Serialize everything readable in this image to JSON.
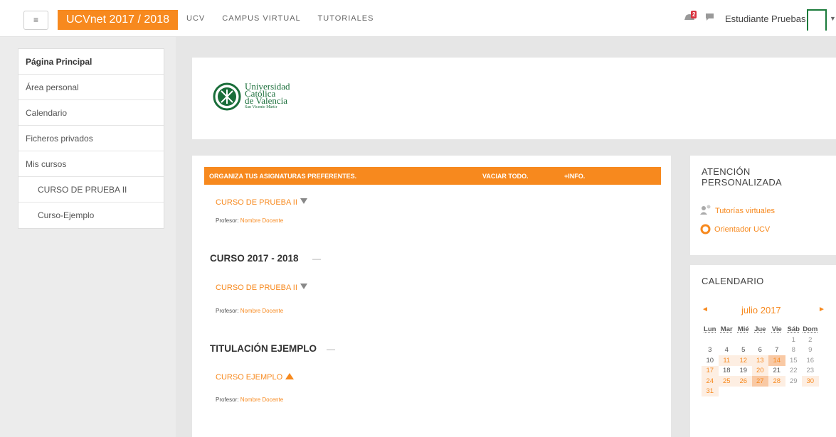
{
  "navbar": {
    "menu_icon": "hamburger-icon",
    "brand": "UCVnet 2017 / 2018",
    "links": [
      "UCV",
      "CAMPUS VIRTUAL",
      "TUTORIALES"
    ],
    "notification_count": "2",
    "username": "Estudiante Pruebas"
  },
  "sidebar": {
    "items": [
      {
        "label": "Página Principal"
      },
      {
        "label": "Área personal"
      },
      {
        "label": "Calendario"
      },
      {
        "label": "Ficheros privados"
      },
      {
        "label": "Mis cursos"
      },
      {
        "label": "CURSO DE PRUEBA II"
      },
      {
        "label": "Curso-Ejemplo"
      }
    ]
  },
  "logo": {
    "line1": "Universidad",
    "line2": "Católica",
    "line3": "de Valencia",
    "line4": "San Vicente Mártir"
  },
  "main": {
    "org_bar": {
      "title": "ORGANIZA TUS ASIGNATURAS PREFERENTES.",
      "clear_all": "VACIAR TODO.",
      "more_info": "+INFO."
    },
    "favorite_course": {
      "name": "CURSO DE PRUEBA II",
      "teacher_label": "Profesor:",
      "teacher_name": "Nombre Docente"
    },
    "sections": [
      {
        "title": "CURSO 2017 - 2018",
        "toggle": "—",
        "course": "CURSO DE PRUEBA II",
        "teacher_label": "Profesor:",
        "teacher_name": "Nombre Docente"
      },
      {
        "title": "TITULACIÓN EJEMPLO",
        "toggle": "—",
        "course": "CURSO EJEMPLO",
        "teacher_label": "Profesor:",
        "teacher_name": "Nombre Docente"
      }
    ]
  },
  "attention": {
    "title_line1": "ATENCIÓN",
    "title_line2": "PERSONALIZADA",
    "links": [
      {
        "label": "Tutorías virtuales",
        "icon": "users-icon"
      },
      {
        "label": "Orientador UCV",
        "icon": "lifebuoy-icon"
      }
    ]
  },
  "calendar": {
    "title": "CALENDARIO",
    "prev": "◄",
    "next": "►",
    "month": "julio 2017",
    "weekdays": [
      "Lun",
      "Mar",
      "Mié",
      "Jue",
      "Vie",
      "Sáb",
      "Dom"
    ],
    "weeks": [
      [
        "",
        "",
        "",
        "",
        "",
        "1",
        "2"
      ],
      [
        "3",
        "4",
        "5",
        "6",
        "7",
        "8",
        "9"
      ],
      [
        "10",
        "11",
        "12",
        "13",
        "14",
        "15",
        "16"
      ],
      [
        "17",
        "18",
        "19",
        "20",
        "21",
        "22",
        "23"
      ],
      [
        "24",
        "25",
        "26",
        "27",
        "28",
        "29",
        "30"
      ],
      [
        "31",
        "",
        "",
        "",
        "",
        "",
        ""
      ]
    ],
    "event_days": [
      "11",
      "12",
      "13",
      "17",
      "20",
      "24",
      "25",
      "26",
      "28",
      "30",
      "31"
    ],
    "highlight_days": [
      "14",
      "27"
    ],
    "accent_color": "#f7891e"
  }
}
